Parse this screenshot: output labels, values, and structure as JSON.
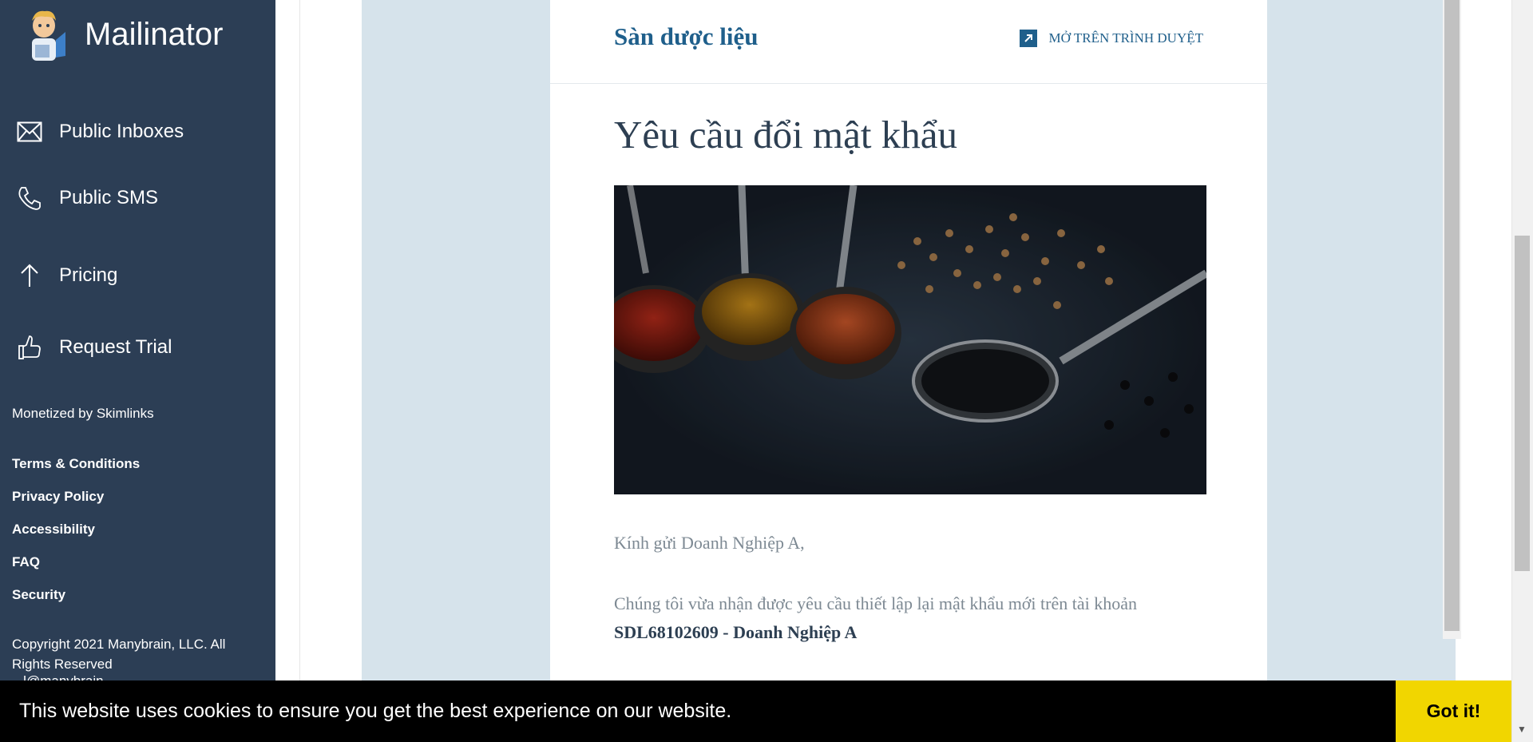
{
  "sidebar": {
    "brand_name": "Mailinator",
    "nav": [
      {
        "label": "Public Inboxes",
        "icon": "envelope-icon"
      },
      {
        "label": "Public SMS",
        "icon": "phone-icon"
      },
      {
        "label": "Pricing",
        "icon": "arrow-up-icon"
      },
      {
        "label": "Request Trial",
        "icon": "thumbs-up-icon"
      }
    ],
    "monetized": "Monetized by Skimlinks",
    "footer_links": [
      "Terms & Conditions",
      "Privacy Policy",
      "Accessibility",
      "FAQ",
      "Security"
    ],
    "copyright": "Copyright 2021 Manybrain, LLC. All Rights Reserved",
    "email_partial": "...l@manybrain..."
  },
  "email": {
    "shop_name": "Sàn dược liệu",
    "open_in_browser": "MỞ TRÊN TRÌNH DUYỆT",
    "title": "Yêu cầu đổi mật khẩu",
    "greeting": "Kính gửi Doanh Nghiệp A,",
    "paragraph_text": "Chúng tôi vừa nhận được yêu cầu thiết lập lại mật khẩu mới trên tài khoản",
    "paragraph_bold": "SDL68102609 - Doanh Nghiệp A",
    "paragraph_cut": "..."
  },
  "cookie": {
    "message": "This website uses cookies to ensure you get the best experience on our website.",
    "button": "Got it!"
  },
  "colors": {
    "sidebar_bg": "#2c3e55",
    "email_bg": "#d6e3eb",
    "accent": "#1f5f8b",
    "cookie_button": "#f1d600"
  }
}
